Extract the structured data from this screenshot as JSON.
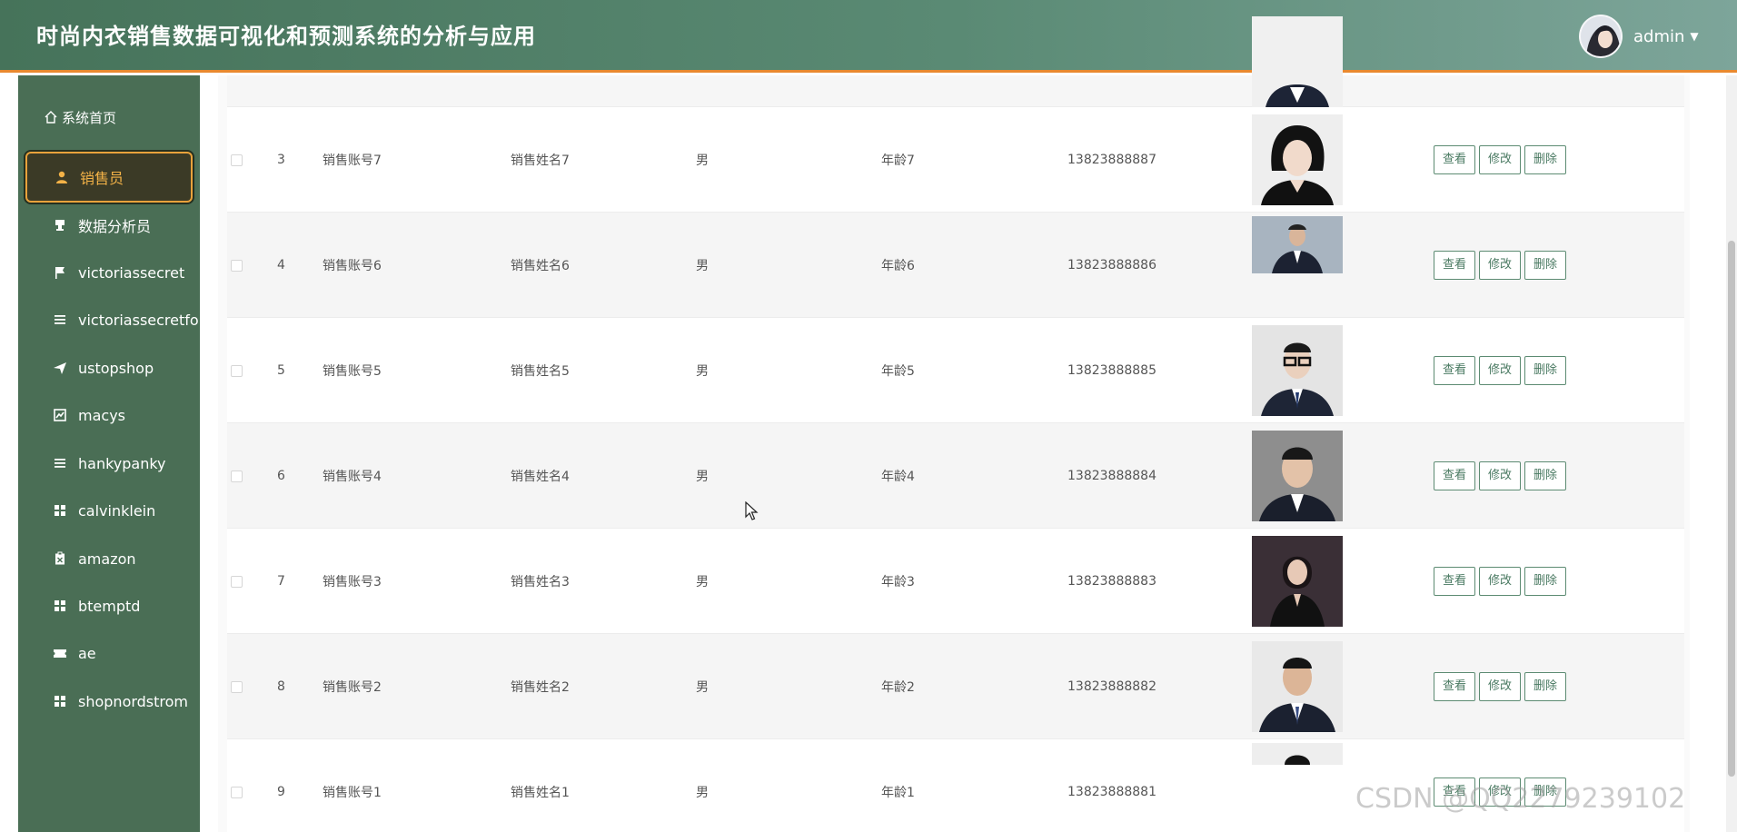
{
  "header": {
    "title": "时尚内衣销售数据可视化和预测系统的分析与应用",
    "username": "admin",
    "caret": "▼"
  },
  "sidebar": {
    "home_label": "系统首页",
    "items": [
      {
        "label": "销售员",
        "icon": "user-icon",
        "active": true
      },
      {
        "label": "数据分析员",
        "icon": "stamp-icon"
      },
      {
        "label": "victoriassecret",
        "icon": "flag-icon"
      },
      {
        "label": "victoriassecretforecast",
        "icon": "list-icon"
      },
      {
        "label": "ustopshop",
        "icon": "send-icon"
      },
      {
        "label": "macys",
        "icon": "chart-icon"
      },
      {
        "label": "hankypanky",
        "icon": "list-icon"
      },
      {
        "label": "calvinklein",
        "icon": "grid-icon"
      },
      {
        "label": "amazon",
        "icon": "clipboard-icon"
      },
      {
        "label": "btemptd",
        "icon": "grid-icon"
      },
      {
        "label": "ae",
        "icon": "ticket-icon"
      },
      {
        "label": "shopnordstrom",
        "icon": "grid-icon"
      }
    ]
  },
  "table": {
    "rows": [
      {
        "index": "3",
        "account": "销售账号7",
        "name": "销售姓名7",
        "sex": "男",
        "age": "年龄7",
        "phone": "13823888887"
      },
      {
        "index": "4",
        "account": "销售账号6",
        "name": "销售姓名6",
        "sex": "男",
        "age": "年龄6",
        "phone": "13823888886"
      },
      {
        "index": "5",
        "account": "销售账号5",
        "name": "销售姓名5",
        "sex": "男",
        "age": "年龄5",
        "phone": "13823888885"
      },
      {
        "index": "6",
        "account": "销售账号4",
        "name": "销售姓名4",
        "sex": "男",
        "age": "年龄4",
        "phone": "13823888884"
      },
      {
        "index": "7",
        "account": "销售账号3",
        "name": "销售姓名3",
        "sex": "男",
        "age": "年龄3",
        "phone": "13823888883"
      },
      {
        "index": "8",
        "account": "销售账号2",
        "name": "销售姓名2",
        "sex": "男",
        "age": "年龄2",
        "phone": "13823888882"
      },
      {
        "index": "9",
        "account": "销售账号1",
        "name": "销售姓名1",
        "sex": "男",
        "age": "年龄1",
        "phone": "13823888881"
      }
    ],
    "actions": {
      "view": "查看",
      "edit": "修改",
      "delete": "删除"
    }
  },
  "watermark": "CSDN @QQ2279239102",
  "colors": {
    "header": "#4f7d63",
    "sidebar": "#4a6e55",
    "accent": "#e9a23b",
    "button_text": "#4a7a62"
  }
}
